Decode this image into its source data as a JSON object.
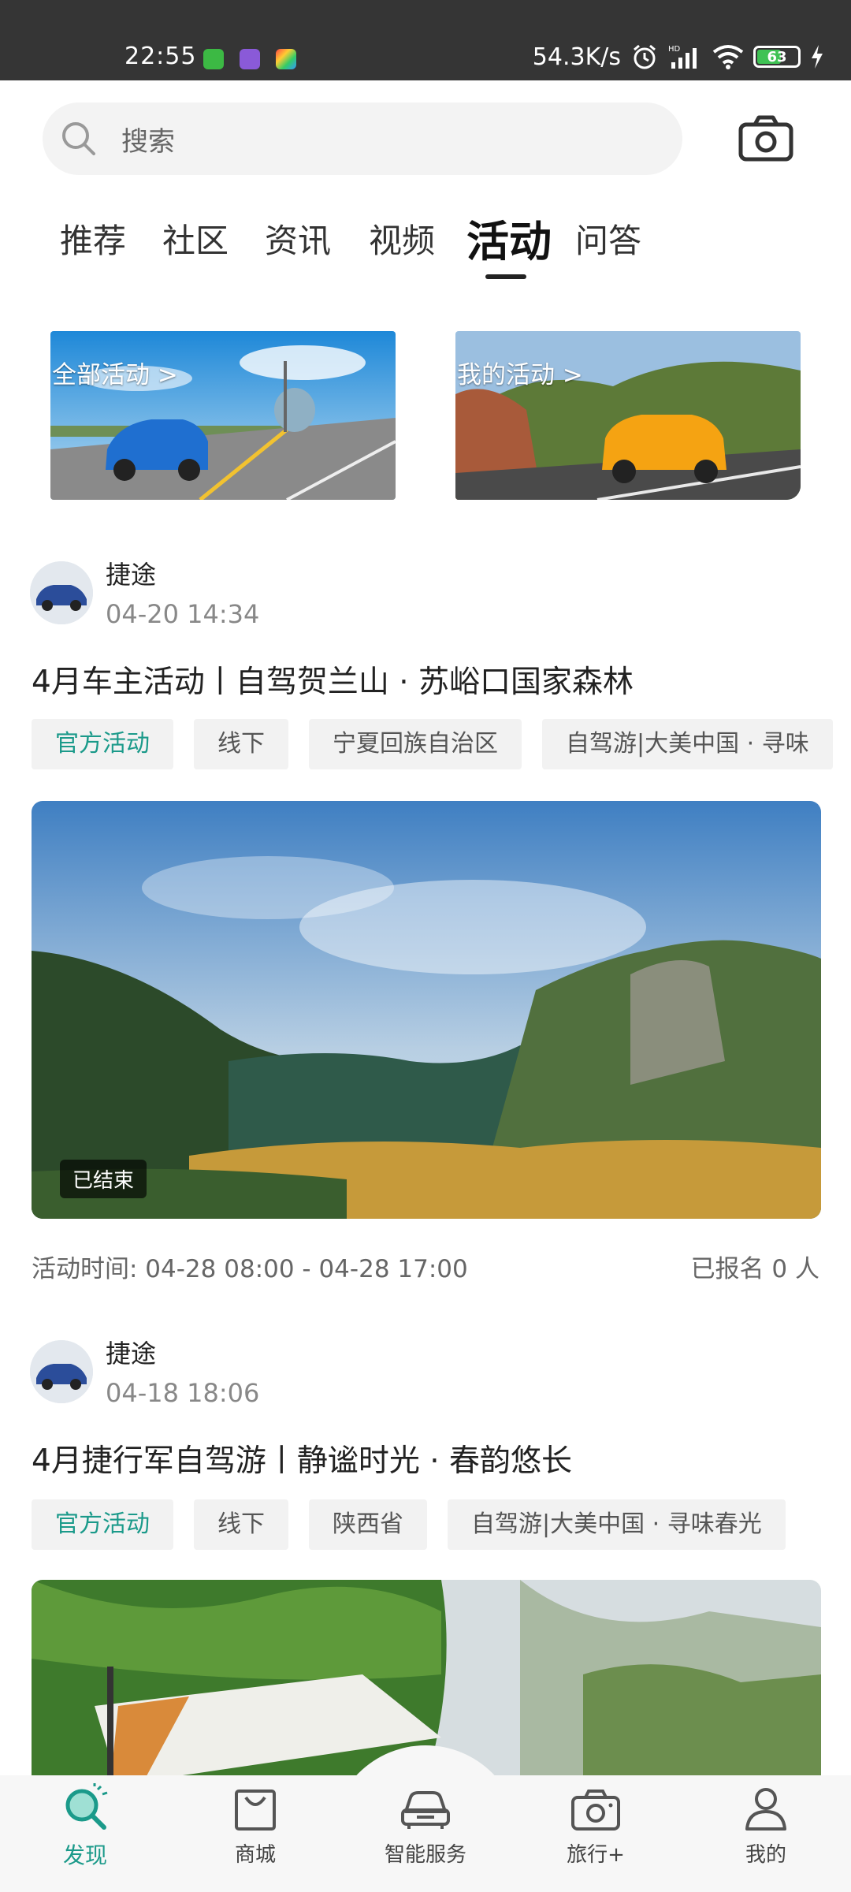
{
  "status_bar": {
    "time": "22:55",
    "network_speed": "54.3K/s",
    "battery": "63",
    "battery_level": 0.63
  },
  "search": {
    "placeholder": "搜索"
  },
  "tabs": [
    {
      "label": "推荐"
    },
    {
      "label": "社区"
    },
    {
      "label": "资讯"
    },
    {
      "label": "视频"
    },
    {
      "label": "活动",
      "active": true
    },
    {
      "label": "问答"
    }
  ],
  "banners": [
    {
      "label": "全部活动 >"
    },
    {
      "label": "我的活动 >"
    }
  ],
  "posts": [
    {
      "author": "捷途",
      "time": "04-20 14:34",
      "title": "4月车主活动丨自驾贺兰山 · 苏峪口国家森林",
      "tags": [
        "官方活动",
        "线下",
        "宁夏回族自治区",
        "自驾游|大美中国 · 寻味"
      ],
      "status": "已结束",
      "activity_time": "活动时间: 04-28 08:00 - 04-28 17:00",
      "signup": "已报名 0 人"
    },
    {
      "author": "捷途",
      "time": "04-18 18:06",
      "title": "4月捷行军自驾游丨静谧时光 · 春韵悠长",
      "tags": [
        "官方活动",
        "线下",
        "陕西省",
        "自驾游|大美中国 · 寻味春光"
      ]
    }
  ],
  "bottom_nav": [
    {
      "label": "发现",
      "icon": "discover-icon",
      "active": true
    },
    {
      "label": "商城",
      "icon": "shop-bag-icon"
    },
    {
      "label": "智能服务",
      "icon": "car-service-icon"
    },
    {
      "label": "旅行+",
      "icon": "travel-camera-icon"
    },
    {
      "label": "我的",
      "icon": "profile-icon"
    }
  ],
  "colors": {
    "accent": "#1b9a8a",
    "status_bar": "#353535",
    "battery": "#3fc254"
  }
}
